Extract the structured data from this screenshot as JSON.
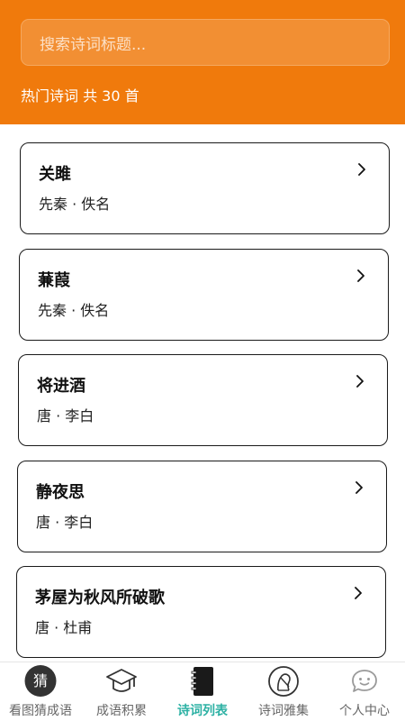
{
  "search": {
    "placeholder": "搜索诗词标题..."
  },
  "summary": {
    "text": "热门诗词 共 30 首"
  },
  "poems": [
    {
      "title": "关雎",
      "meta": "先秦 · 佚名"
    },
    {
      "title": "蒹葭",
      "meta": "先秦 · 佚名"
    },
    {
      "title": "将进酒",
      "meta": "唐 · 李白"
    },
    {
      "title": "静夜思",
      "meta": "唐 · 李白"
    },
    {
      "title": "茅屋为秋风所破歌",
      "meta": "唐 · 杜甫"
    }
  ],
  "tabs": [
    {
      "label": "看图猜成语",
      "glyph": "猜",
      "icon": "guess-badge-icon"
    },
    {
      "label": "成语积累",
      "icon": "graduation-cap-icon"
    },
    {
      "label": "诗词列表",
      "icon": "notebook-icon",
      "active": true
    },
    {
      "label": "诗词雅集",
      "icon": "poet-portrait-icon"
    },
    {
      "label": "个人中心",
      "icon": "smile-chat-icon"
    }
  ],
  "colors": {
    "header": "#f07a0c",
    "active_tab": "#2db1a4"
  }
}
